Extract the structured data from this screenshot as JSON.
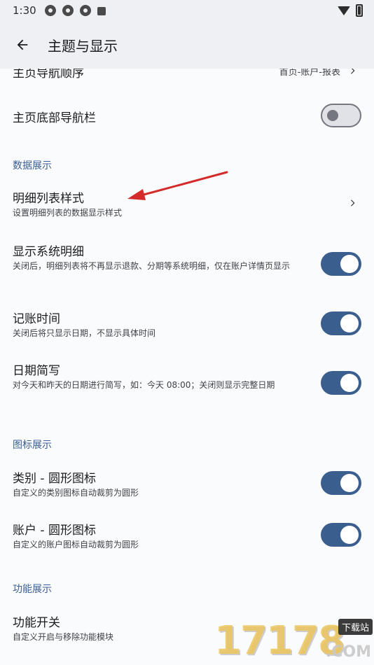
{
  "status_bar": {
    "time": "1:30"
  },
  "app_bar": {
    "title": "主题与显示"
  },
  "rows": {
    "home_nav_order": {
      "label": "主页导航顺序",
      "value": "首页-账户-报表"
    },
    "home_bottom_nav": {
      "label": "主页底部导航栏",
      "toggle": "off"
    },
    "detail_list_style": {
      "label": "明细列表样式",
      "sub": "设置明细列表的数据显示样式"
    },
    "show_system_detail": {
      "label": "显示系统明细",
      "sub": "关闭后，明细列表将不再显示退款、分期等系统明细，仅在账户详情页显示",
      "toggle": "on"
    },
    "record_time": {
      "label": "记账时间",
      "sub": "关闭后将只显示日期，不显示具体时间",
      "toggle": "on"
    },
    "date_short": {
      "label": "日期简写",
      "sub": "对今天和昨天的日期进行简写，如：今天 08:00；关闭则显示完整日期",
      "toggle": "on"
    },
    "category_round_icon": {
      "label": "类别 - 圆形图标",
      "sub": "自定义的类别图标自动裁剪为圆形",
      "toggle": "on"
    },
    "account_round_icon": {
      "label": "账户 - 圆形图标",
      "sub": "自定义的账户图标自动裁剪为圆形",
      "toggle": "on"
    },
    "feature_switch": {
      "label": "功能开关",
      "sub": "自定义开启与移除功能模块"
    }
  },
  "sections": {
    "data_display": "数据展示",
    "icon_display": "图标展示",
    "feature_display": "功能展示"
  },
  "watermark": {
    "number": "17178",
    "tag": "下载站",
    "suffix": ".COM"
  },
  "colors": {
    "accent": "#3a5f8e",
    "section": "#3a5e93",
    "bar": "#eef0f4",
    "annotation_arrow": "#d42a2a"
  }
}
